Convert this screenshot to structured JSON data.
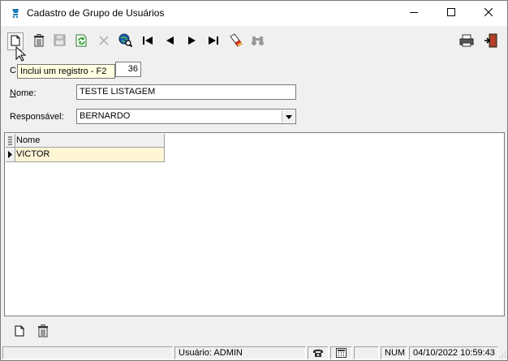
{
  "window": {
    "title": "Cadastro de Grupo de Usuários",
    "controls": {
      "minimize": "minimize-icon",
      "maximize": "maximize-icon",
      "close": "close-icon"
    }
  },
  "toolbar": {
    "buttons": [
      {
        "name": "new-record-button",
        "icon": "new-document-icon"
      },
      {
        "name": "delete-button",
        "icon": "trash-icon"
      },
      {
        "name": "save-button",
        "icon": "floppy-disk-icon"
      },
      {
        "name": "refresh-button",
        "icon": "refresh-icon"
      },
      {
        "name": "cancel-button",
        "icon": "x-icon"
      },
      {
        "name": "search-button",
        "icon": "search-globe-icon"
      },
      {
        "name": "first-record-button",
        "icon": "first-icon"
      },
      {
        "name": "previous-record-button",
        "icon": "previous-icon"
      },
      {
        "name": "next-record-button",
        "icon": "next-icon"
      },
      {
        "name": "last-record-button",
        "icon": "last-icon"
      },
      {
        "name": "clear-filter-button",
        "icon": "eraser-icon"
      },
      {
        "name": "find-button",
        "icon": "binoculars-icon"
      },
      {
        "name": "print-button",
        "icon": "printer-icon"
      },
      {
        "name": "exit-button",
        "icon": "exit-door-icon"
      }
    ]
  },
  "tooltip": {
    "text": "Inclui um registro - F2"
  },
  "form": {
    "codigo": {
      "label_prefix": "C",
      "value": "36"
    },
    "nome": {
      "label_u": "N",
      "label_rest": "ome:",
      "value": "TESTE LISTAGEM"
    },
    "responsavel": {
      "label": "Responsável:",
      "value": "BERNARDO"
    }
  },
  "grid": {
    "columns": [
      "Nome"
    ],
    "rows": [
      [
        "VICTOR"
      ]
    ]
  },
  "statusbar": {
    "user": "Usuário: ADMIN",
    "num": "NUM",
    "datetime": "04/10/2022 10:59:43"
  },
  "colors": {
    "selected_row": "#fff6d6",
    "tooltip_bg": "#ffffe1",
    "accent_icon": "#1c7bb8"
  }
}
